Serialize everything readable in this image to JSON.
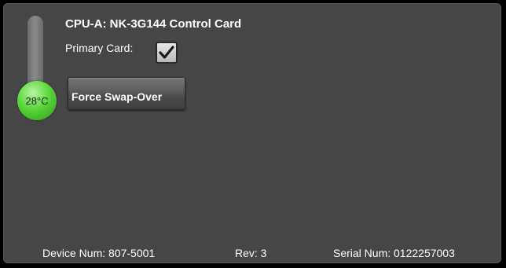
{
  "card": {
    "title": "CPU-A: NK-3G144 Control Card",
    "temperature": "28°C",
    "primary_label": "Primary Card:",
    "primary_checked": true,
    "swap_button_label": "Force Swap-Over"
  },
  "footer": {
    "device_num": "Device Num: 807-5001",
    "rev": "Rev: 3",
    "serial_num": "Serial Num: 0122257003"
  },
  "colors": {
    "panel_bg": "#464646",
    "thermometer_bulb": "#5ad63a",
    "text": "#ffffff"
  },
  "icons": {
    "thermometer": "thermometer-icon",
    "checkmark": "checkmark-icon"
  }
}
